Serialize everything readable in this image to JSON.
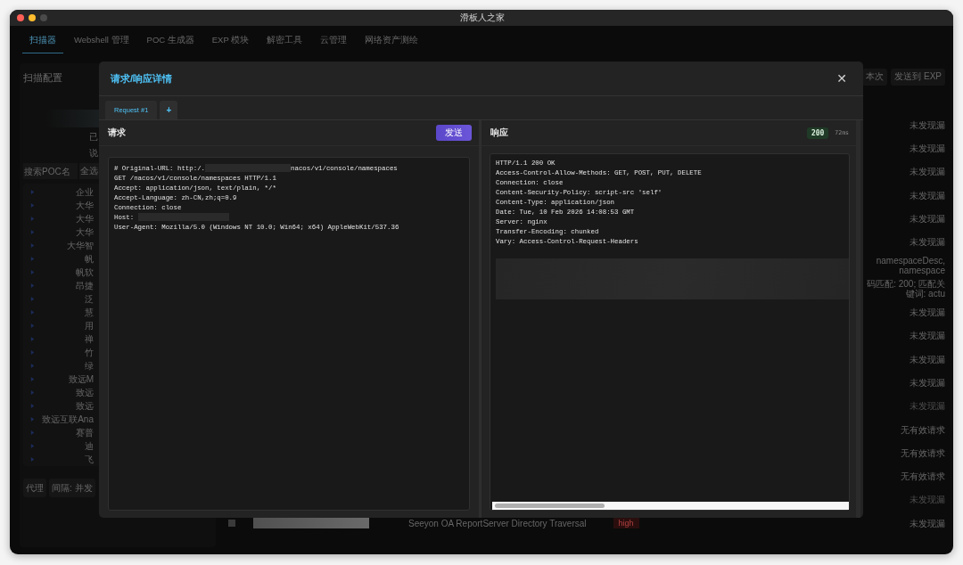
{
  "window": {
    "title": "滑板人之家"
  },
  "nav_tabs": [
    {
      "label": "扫描器",
      "selected": true
    },
    {
      "label": "Webshell 管理",
      "selected": false
    },
    {
      "label": "POC 生成器",
      "selected": false
    },
    {
      "label": "EXP 模块",
      "selected": false
    },
    {
      "label": "解密工具",
      "selected": false
    },
    {
      "label": "云管理",
      "selected": false
    },
    {
      "label": "网络资产测绘",
      "selected": false
    }
  ],
  "scan_config": {
    "title": "扫描配置",
    "notes": [
      "已",
      "说"
    ],
    "search": {
      "placeholder": "搜索POC名"
    },
    "select_all": "全选",
    "poc_items": [
      "企业",
      "大华",
      "大华",
      "大华",
      "大华智",
      "帆",
      "帆软",
      "昂捷",
      "泛",
      "慧",
      "用",
      "禅",
      "竹",
      "绿",
      "致远M",
      "致远",
      "致远",
      "致远互联Ana",
      "赛普",
      "迪",
      "飞"
    ],
    "buttons": [
      "代理",
      "间隔: 并发"
    ]
  },
  "toolbar_buttons": [
    "本次",
    "发送到 EXP"
  ],
  "results": [
    {
      "text": "未发现漏",
      "dim": false
    },
    {
      "text": "未发现漏",
      "dim": false
    },
    {
      "text": "未发现漏",
      "dim": false
    },
    {
      "text": "未发现漏",
      "dim": false
    },
    {
      "text": "未发现漏",
      "dim": false
    },
    {
      "text": "未发现漏",
      "dim": false
    },
    {
      "text": "namespaceDesc, namespace",
      "dim": false
    },
    {
      "text": "码匹配: 200; 匹配关键词: actu",
      "dim": false
    },
    {
      "text": "未发现漏",
      "dim": false
    },
    {
      "text": "未发现漏",
      "dim": false
    },
    {
      "text": "未发现漏",
      "dim": false
    },
    {
      "text": "未发现漏",
      "dim": false
    },
    {
      "text": "未发现漏",
      "dim": true
    },
    {
      "text": "无有效请求",
      "dim": false
    },
    {
      "text": "无有效请求",
      "dim": false
    },
    {
      "text": "无有效请求",
      "dim": false
    },
    {
      "text": "未发现漏",
      "dim": true
    }
  ],
  "bottom_row": {
    "checked": false,
    "name": "Seeyon OA ReportServer Directory Traversal",
    "severity": "high",
    "status": "未发现漏"
  },
  "modal": {
    "title": "请求/响应详情",
    "close": "✕",
    "tabs": [
      {
        "label": "Request #1",
        "selected": true
      }
    ],
    "add_tab": "+",
    "request": {
      "title": "请求",
      "send": "发送",
      "lines": [
        [
          {
            "kind": "text",
            "text": "# Original-URL: http:/."
          },
          {
            "kind": "redacted"
          },
          {
            "kind": "text",
            "text": "nacos/v1/console/namespaces"
          }
        ],
        [
          {
            "kind": "text",
            "text": "GET /nacos/v1/console/namespaces HTTP/1.1"
          }
        ],
        [
          {
            "kind": "text",
            "text": "Accept: application/json, text/plain, */*"
          }
        ],
        [
          {
            "kind": "text",
            "text": "Accept-Language: zh-CN,zh;q=0.9"
          }
        ],
        [
          {
            "kind": "text",
            "text": "Connection: close"
          }
        ],
        [
          {
            "kind": "text",
            "text": "Host: "
          },
          {
            "kind": "redacted"
          }
        ],
        [
          {
            "kind": "text",
            "text": "User-Agent: Mozilla/5.0 (Windows NT 10.0; Win64; x64) AppleWebKit/537.36"
          }
        ]
      ]
    },
    "response": {
      "title": "响应",
      "status": "200",
      "time": "72ms",
      "lines": [
        "HTTP/1.1 200 OK",
        "Access-Control-Allow-Methods: GET, POST, PUT, DELETE",
        "Connection: close",
        "Content-Security-Policy: script-src 'self'",
        "Content-Type: application/json",
        "Date: Tue, 10 Feb 2026 14:08:53 GMT",
        "Server: nginx",
        "Transfer-Encoding: chunked",
        "Vary: Access-Control-Request-Headers"
      ],
      "redacted_body": true
    }
  }
}
